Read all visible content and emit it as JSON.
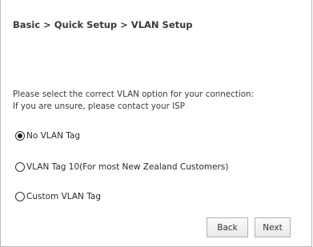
{
  "breadcrumb": "Basic > Quick Setup > VLAN Setup",
  "instructions": {
    "line1": "Please select the correct VLAN option for your connection:",
    "line2": "If you are unsure, please contact your ISP"
  },
  "options": [
    {
      "label": "No VLAN Tag",
      "selected": true
    },
    {
      "label": "VLAN Tag 10(For most New Zealand Customers)",
      "selected": false
    },
    {
      "label": "Custom VLAN Tag",
      "selected": false
    }
  ],
  "buttons": {
    "back_label": "Back",
    "next_label": "Next"
  }
}
